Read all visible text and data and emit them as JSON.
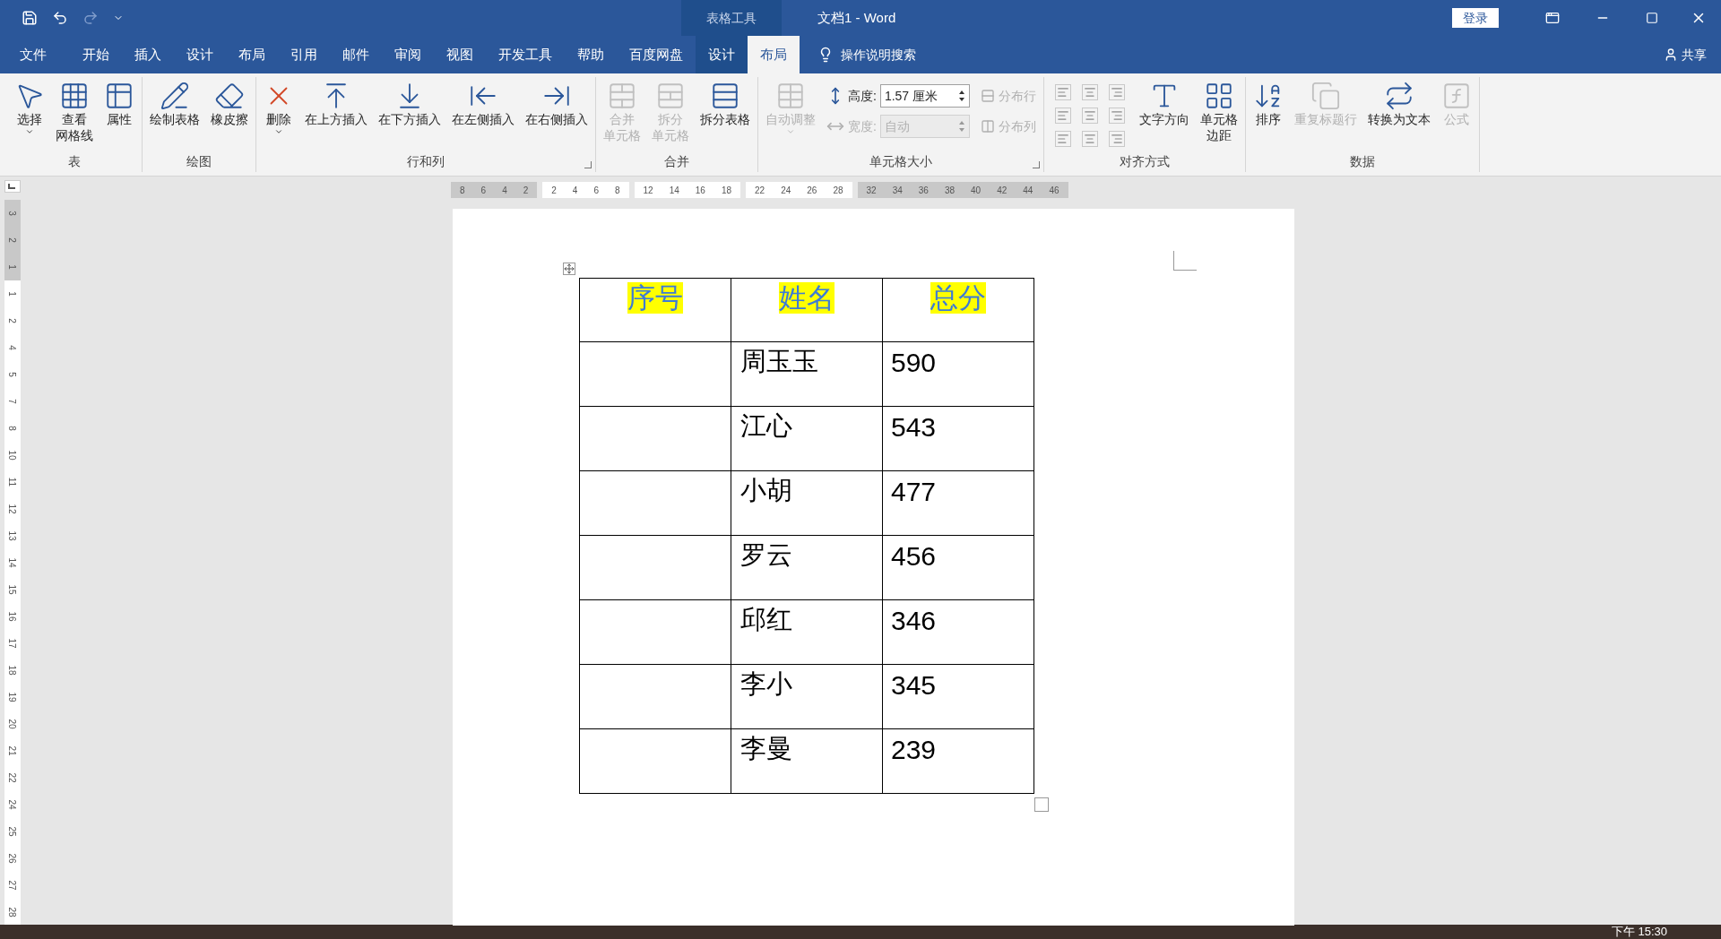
{
  "window": {
    "title": "文档1  -  Word",
    "context_tab": "表格工具",
    "login": "登录"
  },
  "menu_tabs": [
    {
      "label": "文件",
      "selected": false
    },
    {
      "label": "开始",
      "selected": false
    },
    {
      "label": "插入",
      "selected": false
    },
    {
      "label": "设计",
      "selected": false
    },
    {
      "label": "布局",
      "selected": false
    },
    {
      "label": "引用",
      "selected": false
    },
    {
      "label": "邮件",
      "selected": false
    },
    {
      "label": "审阅",
      "selected": false
    },
    {
      "label": "视图",
      "selected": false
    },
    {
      "label": "开发工具",
      "selected": false
    },
    {
      "label": "帮助",
      "selected": false
    },
    {
      "label": "百度网盘",
      "selected": false
    }
  ],
  "context_tabs": [
    {
      "label": "设计",
      "selected": false
    },
    {
      "label": "布局",
      "selected": true
    }
  ],
  "search": "操作说明搜索",
  "share": "共享",
  "ribbon_groups": [
    {
      "label": "表",
      "launcher": false,
      "items": [
        {
          "kind": "large",
          "lines": [
            "选择"
          ],
          "dropdown": true,
          "disabled": false
        },
        {
          "kind": "large",
          "lines": [
            "查看",
            "网格线"
          ],
          "dropdown": false,
          "disabled": false
        },
        {
          "kind": "large",
          "lines": [
            "属性"
          ],
          "dropdown": false,
          "disabled": false
        }
      ]
    },
    {
      "label": "绘图",
      "launcher": false,
      "items": [
        {
          "kind": "large",
          "lines": [
            "绘制表格"
          ],
          "dropdown": false,
          "disabled": false
        },
        {
          "kind": "large",
          "lines": [
            "橡皮擦"
          ],
          "dropdown": false,
          "disabled": false
        }
      ]
    },
    {
      "label": "行和列",
      "launcher": true,
      "items": [
        {
          "kind": "large",
          "lines": [
            "删除"
          ],
          "dropdown": true,
          "disabled": false
        },
        {
          "kind": "large",
          "lines": [
            "在上方插入"
          ],
          "dropdown": false,
          "disabled": false
        },
        {
          "kind": "large",
          "lines": [
            "在下方插入"
          ],
          "dropdown": false,
          "disabled": false
        },
        {
          "kind": "large",
          "lines": [
            "在左侧插入"
          ],
          "dropdown": false,
          "disabled": false
        },
        {
          "kind": "large",
          "lines": [
            "在右侧插入"
          ],
          "dropdown": false,
          "disabled": false
        }
      ]
    },
    {
      "label": "合并",
      "launcher": false,
      "items": [
        {
          "kind": "large",
          "lines": [
            "合并",
            "单元格"
          ],
          "dropdown": false,
          "disabled": true
        },
        {
          "kind": "large",
          "lines": [
            "拆分",
            "单元格"
          ],
          "dropdown": false,
          "disabled": true
        },
        {
          "kind": "large",
          "lines": [
            "拆分表格"
          ],
          "dropdown": false,
          "disabled": false
        }
      ]
    },
    {
      "label": "单元格大小",
      "launcher": true,
      "items": [
        {
          "kind": "large",
          "lines": [
            "自动调整"
          ],
          "dropdown": true,
          "disabled": true
        },
        {
          "kind": "field",
          "label": "高度:",
          "value": "1.57 厘米",
          "disabled": false
        },
        {
          "kind": "field",
          "label": "宽度:",
          "value": "自动",
          "disabled": true
        },
        {
          "kind": "small",
          "label": "分布行",
          "disabled": true
        },
        {
          "kind": "small",
          "label": "分布列",
          "disabled": true
        }
      ]
    },
    {
      "label": "对齐方式",
      "launcher": false,
      "items": [
        {
          "kind": "align-grid"
        },
        {
          "kind": "large",
          "lines": [
            "文字方向"
          ],
          "dropdown": false,
          "disabled": false
        },
        {
          "kind": "large",
          "lines": [
            "单元格",
            "边距"
          ],
          "dropdown": false,
          "disabled": false
        }
      ]
    },
    {
      "label": "数据",
      "launcher": false,
      "items": [
        {
          "kind": "large",
          "lines": [
            "排序"
          ],
          "dropdown": false,
          "disabled": false
        },
        {
          "kind": "large",
          "lines": [
            "重复标题行"
          ],
          "dropdown": false,
          "disabled": true
        },
        {
          "kind": "large",
          "lines": [
            "转换为文本"
          ],
          "dropdown": false,
          "disabled": false
        },
        {
          "kind": "large",
          "lines": [
            "公式"
          ],
          "dropdown": false,
          "disabled": true
        }
      ]
    }
  ],
  "horizontal_ruler": [
    {
      "shaded": true,
      "labels": [
        "8",
        "6",
        "4",
        "2"
      ]
    },
    {
      "shaded": false,
      "labels": [
        "2",
        "4",
        "6",
        "8"
      ]
    },
    {
      "shaded": false,
      "labels": [
        "12",
        "14",
        "16",
        "18"
      ]
    },
    {
      "shaded": false,
      "labels": [
        "22",
        "24",
        "26",
        "28"
      ]
    },
    {
      "shaded": true,
      "labels": [
        "32",
        "34",
        "36",
        "38",
        "40",
        "42",
        "44",
        "46"
      ]
    }
  ],
  "vertical_ruler": [
    {
      "shaded": true,
      "labels": [
        "3",
        "2",
        "1"
      ]
    },
    {
      "shaded": false,
      "labels": [
        "1",
        "2",
        "4",
        "5",
        "7",
        "8",
        "10",
        "11",
        "12",
        "13",
        "14",
        "15",
        "16",
        "17",
        "18",
        "19",
        "20",
        "21",
        "22",
        "24",
        "25",
        "26",
        "27",
        "28"
      ]
    }
  ],
  "table": {
    "columns": [
      "序号",
      "姓名",
      "总分"
    ],
    "rows": [
      {
        "name": "周玉玉",
        "score": "590"
      },
      {
        "name": "江心",
        "score": "543"
      },
      {
        "name": "小胡",
        "score": "477"
      },
      {
        "name": "罗云",
        "score": "456"
      },
      {
        "name": "邱红",
        "score": "346"
      },
      {
        "name": "李小",
        "score": "345"
      },
      {
        "name": "李曼",
        "score": "239"
      }
    ]
  },
  "taskbar": {
    "clock": "下午 15:30"
  }
}
